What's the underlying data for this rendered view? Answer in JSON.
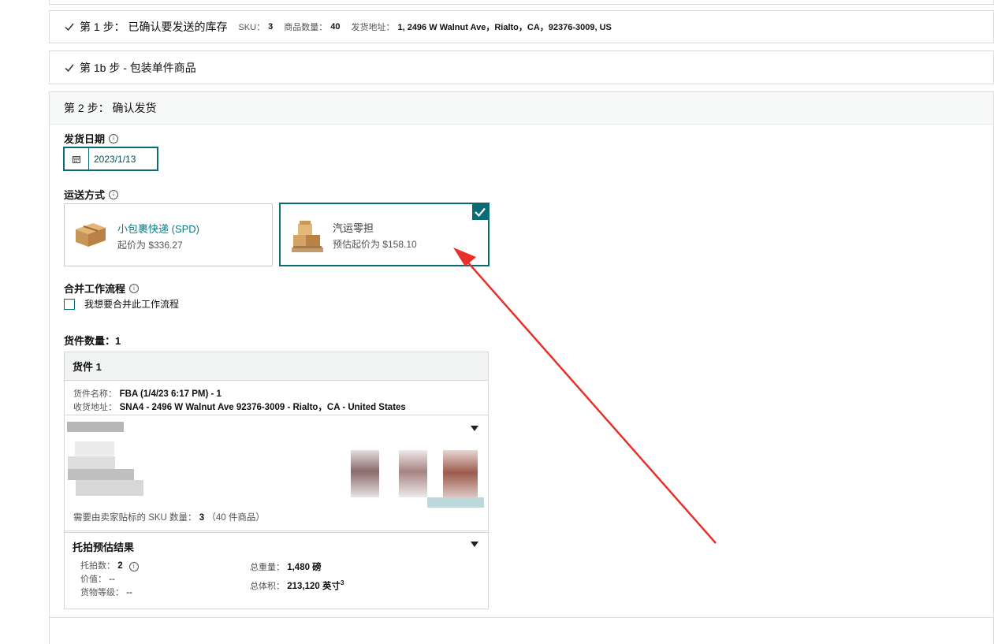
{
  "step1": {
    "title": "第 1 步： 已确认要发送的库存",
    "sku_label": "SKU：",
    "sku_value": "3",
    "qty_label": "商品数量：",
    "qty_value": "40",
    "address_label": "发货地址：",
    "address_value": "1, 2496 W Walnut Ave，Rialto，CA，92376-3009, US"
  },
  "step1b": {
    "title": "第 1b 步 - 包装单件商品"
  },
  "step2": {
    "title": "第 2 步： 确认发货",
    "ship_date_label": "发货日期",
    "ship_date_value": "2023/1/13",
    "shipping_method_label": "运送方式",
    "methods": [
      {
        "title": "小包裹快递 (SPD)",
        "subtitle": "起价为 $336.27",
        "selected": false
      },
      {
        "title": "汽运零担",
        "subtitle": "预估起价为 $158.10",
        "selected": true
      }
    ],
    "merge_label": "合并工作流程",
    "merge_checkbox_label": "我想要合并此工作流程",
    "shipment_count_label": "货件数量：1",
    "shipment": {
      "title": "货件 1",
      "name_label": "货件名称：",
      "name_value": "FBA (1/4/23 6:17 PM) - 1",
      "address_label": "收货地址：",
      "address_value": "SNA4 - 2496 W Walnut Ave 92376-3009 - Rialto，CA - United States",
      "seller_label_text": "需要由卖家贴标的 SKU 数量：",
      "seller_label_value": "3",
      "seller_label_suffix": "（40 件商品）",
      "pallet_title": "托拍预估结果",
      "pallet_count_label": "托拍数：",
      "pallet_count_value": "2",
      "value_label": "价值：",
      "value_value": "--",
      "class_label": "货物等级：",
      "class_value": "--",
      "weight_label": "总重量：",
      "weight_value": "1,480 磅",
      "volume_label": "总体积：",
      "volume_value": "213,120 英寸",
      "volume_sup": "3"
    }
  },
  "colors": {
    "accent": "#0a6b72",
    "link": "#0a7a86",
    "arrow": "#e8302b"
  }
}
